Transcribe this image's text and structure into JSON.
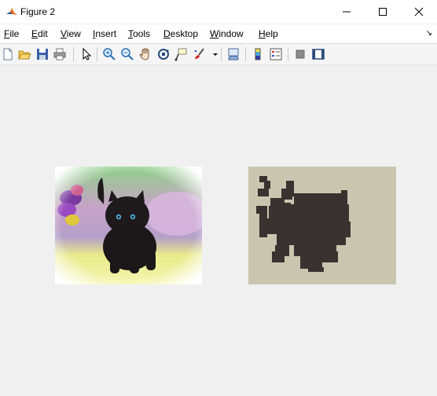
{
  "window": {
    "title": "Figure 2"
  },
  "menu": [
    {
      "key": "F",
      "rest": "ile"
    },
    {
      "key": "E",
      "rest": "dit"
    },
    {
      "key": "V",
      "rest": "iew"
    },
    {
      "key": "I",
      "rest": "nsert"
    },
    {
      "key": "T",
      "rest": "ools"
    },
    {
      "key": "D",
      "rest": "esktop"
    },
    {
      "key": "W",
      "rest": "indow"
    },
    {
      "key": "H",
      "rest": "elp"
    }
  ],
  "toolbar": {
    "icons": [
      "new-figure-icon",
      "open-file-icon",
      "save-icon",
      "print-icon",
      "edit-plot-icon",
      "zoom-in-icon",
      "zoom-out-icon",
      "pan-icon",
      "rotate-3d-icon",
      "data-cursor-icon",
      "brush-icon",
      "link-plot-icon",
      "insert-colorbar-icon",
      "insert-legend-icon",
      "hide-plot-tools-icon",
      "show-plot-tools-icon"
    ]
  },
  "axes": [
    {
      "content": "photo of black kitten with blue eyes on yellow blanket, purple flowers at left"
    },
    {
      "content": "binary segmentation mask of kitten silhouette, dark on tan background"
    }
  ],
  "colors": {
    "mask_bg": "#c9c6b0",
    "mask_fg": "#3a3230",
    "figure_bg": "#f0f0f0"
  }
}
